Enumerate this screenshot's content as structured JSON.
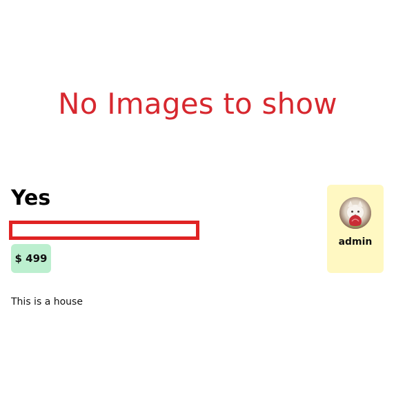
{
  "gallery": {
    "empty_message": "No Images to show"
  },
  "listing": {
    "title": "Yes",
    "price": "$ 499",
    "description": "This is a house"
  },
  "owner": {
    "username": "admin"
  },
  "colors": {
    "empty_message": "#d7282f",
    "status_border": "#e02323",
    "price_badge": "#bcefcf",
    "owner_card": "#fff8c2"
  }
}
